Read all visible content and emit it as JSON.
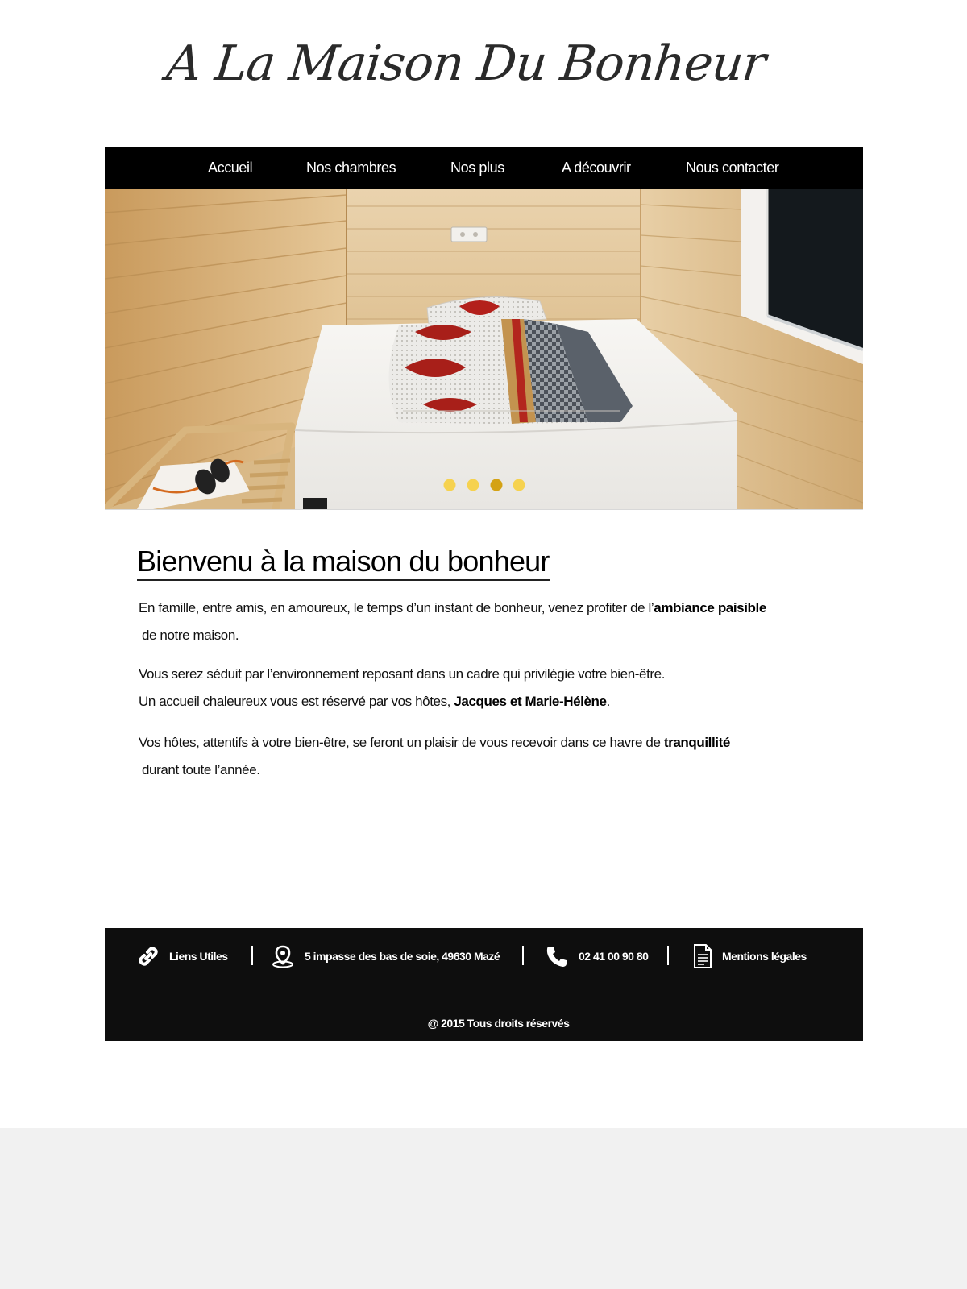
{
  "site": {
    "logo": "A La Maison Du Bonheur"
  },
  "nav": {
    "items": [
      {
        "label": "Accueil"
      },
      {
        "label": "Nos chambres"
      },
      {
        "label": "Nos plus"
      },
      {
        "label": "A découvrir"
      },
      {
        "label": "Nous contacter"
      }
    ]
  },
  "slider": {
    "slide_count": 4,
    "active_index": 3,
    "dot_color": "#f6d24f",
    "active_dot_color": "#d4a214"
  },
  "content": {
    "title": "Bienvenu à la maison du bonheur",
    "p1_before": "En famille, entre amis, en amoureux, le temps d’un instant de bonheur, venez profiter de l’",
    "p1_bold": "ambiance paisible",
    "p1_after": " de notre maison.",
    "p2_line1": "Vous serez séduit par l’environnement reposant dans un cadre qui privilégie votre bien-être.",
    "p2_line2_before": "Un accueil chaleureux vous est réservé par vos hôtes, ",
    "p2_line2_bold": "Jacques et Marie-Hélène",
    "p2_line2_after": ".",
    "p3_before": "Vos hôtes, attentifs à votre bien-être, se feront un plaisir de vous recevoir dans ce havre de ",
    "p3_bold": "tranquillité",
    "p3_after": " durant toute l’année."
  },
  "footer": {
    "links_label": "Liens Utiles",
    "address": "5 impasse des bas de soie, 49630 Mazé",
    "phone": "02 41 00 90 80",
    "legal_label": "Mentions légales",
    "copyright": "@ 2015 Tous droits réservés",
    "icons": {
      "links": "chain-link-icon",
      "address": "map-pin-icon",
      "phone": "phone-icon",
      "legal": "document-icon"
    }
  },
  "colors": {
    "nav_bg": "#000000",
    "footer_bg": "#0e0e0e",
    "page_bg": "#f1f1f1"
  }
}
